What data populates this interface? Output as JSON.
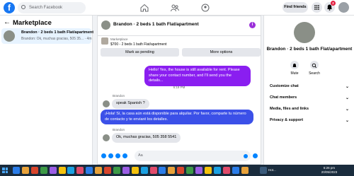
{
  "topbar": {
    "logo": "f",
    "search_placeholder": "Search Facebook",
    "find_friends": "Find friends",
    "notif_count": "2"
  },
  "sidebar": {
    "title": "Marketplace",
    "conversation": {
      "title": "Brandon · 2 beds 1 bath Flat/apartment",
      "preview": "Brandon: Ok, muchas gracias, 505 35... · 4m"
    }
  },
  "chat": {
    "header_name": "Brandon · 2 beds 1 bath Flat/apartment",
    "listing_label": "Marketplace",
    "listing_price": "$700 - 2 beds 1 bath Flat/apartment",
    "mark_pending": "Mark as pending",
    "more_options": "More options",
    "messages": [
      {
        "from": "me",
        "text": "Hello! Yes, the house is still available for rent. Please share your contact number, and I'll send you the details..."
      },
      {
        "from": "them",
        "sender": "Brandon",
        "text": "speak Spanish ?"
      },
      {
        "from": "me",
        "text": "¡Hola! Sí, la casa aún está disponible para alquilar. Por favor, comparte tu número de contacto y te enviaré los detalles."
      },
      {
        "from": "them",
        "sender": "Brandon",
        "text": "Ok, muchas gracias, 505 358 5541"
      }
    ],
    "timestamp": "6:19 PM",
    "composer_placeholder": "Aa"
  },
  "details": {
    "name": "Brandon · 2 beds 1 bath Flat/apartment",
    "mute": "Mute",
    "search": "Search",
    "sections": [
      "Customize chat",
      "Chat members",
      "Media, files and links",
      "Privacy & support"
    ]
  },
  "taskbar": {
    "app_label": "Hot...",
    "time": "6:26 pm",
    "date": "20/05/2023"
  }
}
